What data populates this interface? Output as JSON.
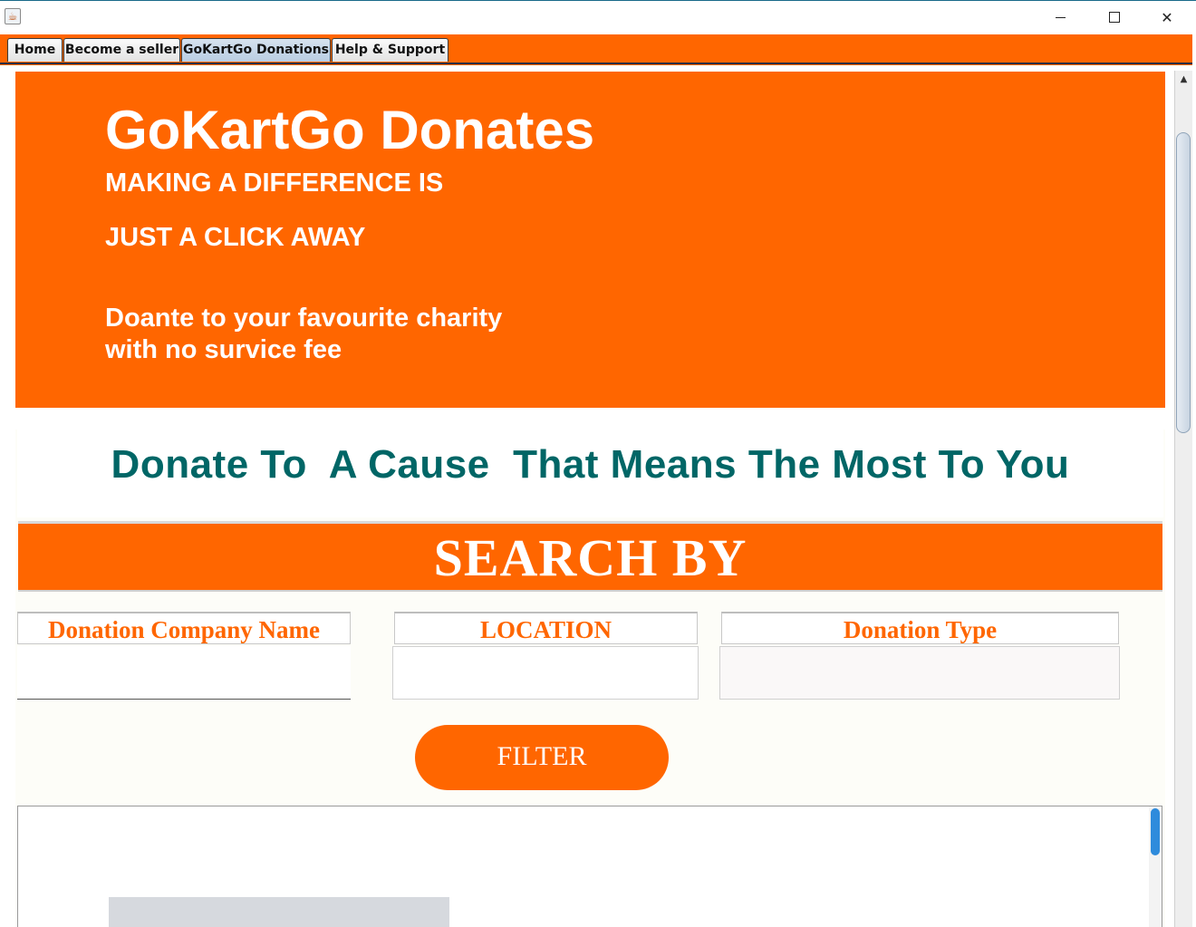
{
  "window": {
    "app_icon": "java-cup-icon",
    "controls": {
      "minimize": "minimize-icon",
      "maximize": "maximize-icon",
      "close": "close-icon",
      "close_glyph": "✕"
    }
  },
  "tabs": [
    {
      "label": "Home",
      "active": false
    },
    {
      "label": "Become a seller",
      "active": false
    },
    {
      "label": "GoKartGo Donations",
      "active": true
    },
    {
      "label": "Help & Support",
      "active": false
    }
  ],
  "hero": {
    "title": "GoKartGo Donates",
    "line1": "MAKING A DIFFERENCE IS",
    "line2": "JUST A CLICK AWAY",
    "description": "Doante to your favourite charity with no survice fee"
  },
  "tagline": "Donate To  A Cause  That Means The Most To You",
  "search": {
    "heading": "SEARCH BY",
    "fields": [
      {
        "label": "Donation Company Name",
        "value": ""
      },
      {
        "label": "LOCATION",
        "value": ""
      },
      {
        "label": "Donation Type",
        "value": ""
      }
    ],
    "filter_label": "FILTER"
  },
  "colors": {
    "brand_orange": "#ff6600",
    "tagline_teal": "#006666",
    "active_tab": "#c7d7e8"
  }
}
